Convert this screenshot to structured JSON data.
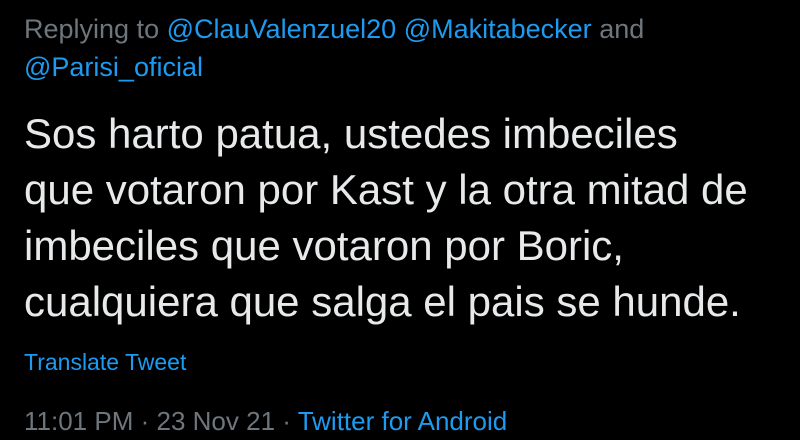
{
  "reply": {
    "prefix": "Replying to",
    "mentions": [
      "@ClauValenzuel20",
      "@Makitabecker",
      "@Parisi_oficial"
    ],
    "conjunction": "and"
  },
  "tweet": {
    "lines": [
      "Sos harto patua, ustedes imbeciles",
      "que votaron por Kast y la otra mitad de",
      "imbeciles que votaron por Boric,",
      "cualquiera que salga el pais se hunde."
    ]
  },
  "translate_label": "Translate Tweet",
  "meta": {
    "time": "11:01 PM",
    "separator": "·",
    "date": "23 Nov 21",
    "source": "Twitter for Android"
  },
  "colors": {
    "background": "#000000",
    "text": "#e7e9ea",
    "muted": "#6e767d",
    "accent": "#1d9bf0"
  }
}
